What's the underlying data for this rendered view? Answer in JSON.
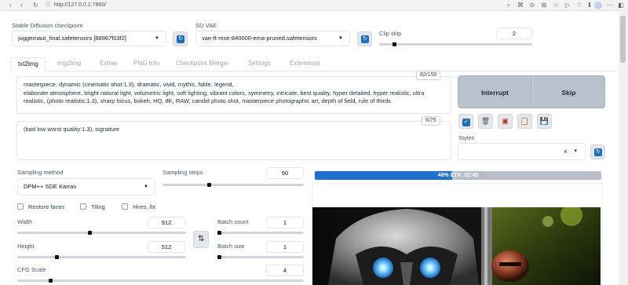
{
  "browser": {
    "url": "http://127.0.0.1:7860/"
  },
  "checkpoint": {
    "label": "Stable Diffusion checkpoint",
    "value": "juggernaut_final.safetensors [88967f03f2]"
  },
  "vae": {
    "label": "SD VAE",
    "value": "vae-ft-mse-840000-ema-pruned.safetensors"
  },
  "clip_skip": {
    "label": "Clip skip",
    "value": "2"
  },
  "tabs": [
    {
      "label": "txt2img"
    },
    {
      "label": "img2img"
    },
    {
      "label": "Extras"
    },
    {
      "label": "PNG Info"
    },
    {
      "label": "Checkpoint Merger"
    },
    {
      "label": "Settings"
    },
    {
      "label": "Extensions"
    }
  ],
  "prompt": {
    "text": "masterpiece, dynamic (cinematic shot:1.3), dramatic, vivid, mythic, fable, legend,\nelaborate atmosphere, bright natural light, volumetric light, soft lighting, vibrant colors, symmetry, intricate, best quality, hyper detailed, hyper realistic, ultra realistic, (photo realistic:1.3), sharp focus, bokeh, HQ, 8K, RAW, candid photo shot, masterpiece photographic art, depth of field, rule of thirds",
    "token_count": "82/150"
  },
  "negative_prompt": {
    "text": "(bad low worst quality:1.3), signature",
    "token_count": "6/75"
  },
  "buttons": {
    "interrupt": "Interrupt",
    "skip": "Skip"
  },
  "tools": [
    {
      "icon": "checkbox-icon",
      "glyph": "✓",
      "color": "#1d6fbe"
    },
    {
      "icon": "trash-icon",
      "glyph": "🗑",
      "color": "#555555"
    },
    {
      "icon": "style-card-icon",
      "glyph": "▣",
      "color": "#b03030"
    },
    {
      "icon": "clipboard-icon",
      "glyph": "📋",
      "color": "#8a6d3b"
    },
    {
      "icon": "save-icon",
      "glyph": "💾",
      "color": "#333333"
    }
  ],
  "styles": {
    "label": "Styles",
    "clear": "×",
    "caret": "▾"
  },
  "sampling_method": {
    "label": "Sampling method",
    "value": "DPM++ SDE Karras"
  },
  "sampling_steps": {
    "label": "Sampling steps",
    "value": "50",
    "min": 1,
    "max": 150
  },
  "checkboxes": [
    {
      "label": "Restore faces",
      "checked": false
    },
    {
      "label": "Tiling",
      "checked": false
    },
    {
      "label": "Hires. fix",
      "checked": false
    }
  ],
  "width": {
    "label": "Width",
    "value": "912",
    "fraction": 0.42
  },
  "height": {
    "label": "Height",
    "value": "512",
    "fraction": 0.23
  },
  "batch_count": {
    "label": "Batch count",
    "value": "1",
    "fraction": 0.0
  },
  "batch_size": {
    "label": "Batch size",
    "value": "1",
    "fraction": 0.0
  },
  "cfg_scale": {
    "label": "CFG Scale",
    "value": "4",
    "fraction": 0.13
  },
  "swap_glyph": "⇅",
  "progress": {
    "text": "48% ETA: 02:49",
    "percent": 48
  },
  "colors": {
    "accent": "#1f6fd0",
    "button_bg": "#b8c1cc",
    "refresh_icon": "#1d6fbe"
  }
}
